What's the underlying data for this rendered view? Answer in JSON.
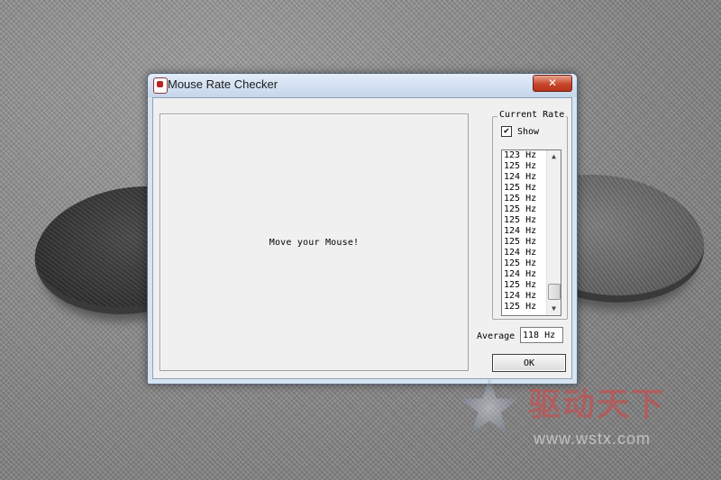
{
  "window": {
    "title": "Mouse Rate Checker",
    "close_symbol": "✕"
  },
  "test_area": {
    "text": "Move your Mouse!"
  },
  "current_rate": {
    "group_label": "Current Rate",
    "show_label": "Show",
    "show_checked": true,
    "check_mark": "✔",
    "items": [
      "123 Hz",
      "125 Hz",
      "124 Hz",
      "125 Hz",
      "125 Hz",
      "125 Hz",
      "125 Hz",
      "124 Hz",
      "125 Hz",
      "124 Hz",
      "125 Hz",
      "124 Hz",
      "125 Hz",
      "124 Hz",
      "125 Hz"
    ],
    "scroll_up": "▲",
    "scroll_down": "▼"
  },
  "average": {
    "label": "Average",
    "value": "118 Hz"
  },
  "ok_label": "OK",
  "watermark": {
    "cn_text": "驱动天下",
    "url": "www.wstx.com"
  },
  "colors": {
    "close_button": "#c7472b",
    "watermark_red": "#d24646"
  }
}
